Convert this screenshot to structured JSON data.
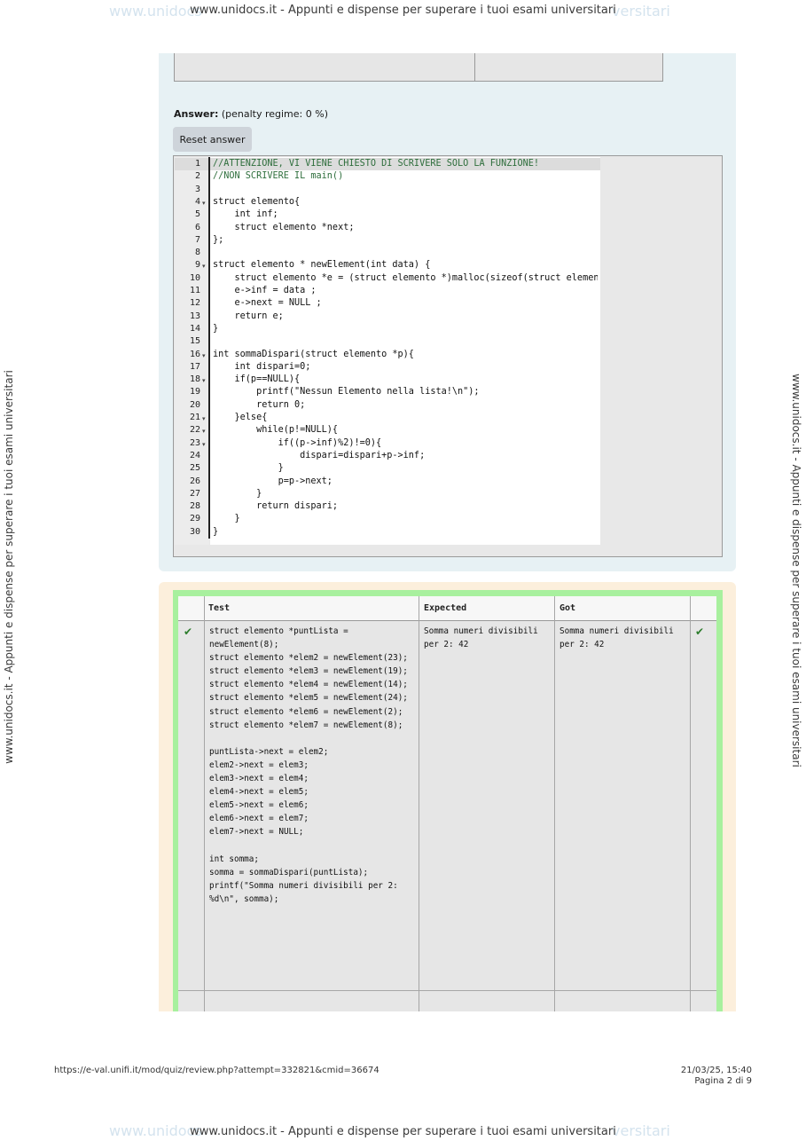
{
  "watermark": {
    "top": "www.unidocs.it - Appunti e dispense per superare i tuoi esami universitari",
    "bottom": "www.unidocs.it - Appunti e dispense per superare i tuoi esami universitari",
    "left": "www.unidocs.it - Appunti e dispense per superare i tuoi esami universitari",
    "right": "www.unidocs.it - Appunti e dispense per superare i tuoi esami universitari",
    "ghost_left": "www.unidocs",
    "ghost_right": "versitari"
  },
  "answer": {
    "label": "Answer:",
    "penalty": "(penalty regime: 0 %)",
    "reset_button": "Reset answer"
  },
  "code_lines": [
    {
      "n": "1",
      "text": "//ATTENZIONE, VI VIENE CHIESTO DI SCRIVERE SOLO LA FUNZIONE!",
      "comment": true
    },
    {
      "n": "2",
      "text": "//NON SCRIVERE IL main()",
      "comment": true
    },
    {
      "n": "3",
      "text": ""
    },
    {
      "n": "4",
      "text": "struct elemento{",
      "fold": true
    },
    {
      "n": "5",
      "text": "    int inf;"
    },
    {
      "n": "6",
      "text": "    struct elemento *next;"
    },
    {
      "n": "7",
      "text": "};"
    },
    {
      "n": "8",
      "text": ""
    },
    {
      "n": "9",
      "text": "struct elemento * newElement(int data) {",
      "fold": true
    },
    {
      "n": "10",
      "text": "    struct elemento *e = (struct elemento *)malloc(sizeof(struct elemento));"
    },
    {
      "n": "11",
      "text": "    e->inf = data ;"
    },
    {
      "n": "12",
      "text": "    e->next = NULL ;"
    },
    {
      "n": "13",
      "text": "    return e;"
    },
    {
      "n": "14",
      "text": "}"
    },
    {
      "n": "15",
      "text": ""
    },
    {
      "n": "16",
      "text": "int sommaDispari(struct elemento *p){",
      "fold": true
    },
    {
      "n": "17",
      "text": "    int dispari=0;"
    },
    {
      "n": "18",
      "text": "    if(p==NULL){",
      "fold": true
    },
    {
      "n": "19",
      "text": "        printf(\"Nessun Elemento nella lista!\\n\");"
    },
    {
      "n": "20",
      "text": "        return 0;"
    },
    {
      "n": "21",
      "text": "    }else{",
      "fold": true
    },
    {
      "n": "22",
      "text": "        while(p!=NULL){",
      "fold": true
    },
    {
      "n": "23",
      "text": "            if((p->inf)%2)!=0){",
      "fold": true
    },
    {
      "n": "24",
      "text": "                dispari=dispari+p->inf;"
    },
    {
      "n": "25",
      "text": "            }"
    },
    {
      "n": "26",
      "text": "            p=p->next;"
    },
    {
      "n": "27",
      "text": "        }"
    },
    {
      "n": "28",
      "text": "        return dispari;"
    },
    {
      "n": "29",
      "text": "    }"
    },
    {
      "n": "30",
      "text": "}"
    }
  ],
  "results": {
    "headers": {
      "test": "Test",
      "expected": "Expected",
      "got": "Got"
    },
    "row": {
      "test": "struct elemento *puntLista = newElement(8);\nstruct elemento *elem2 = newElement(23);\nstruct elemento *elem3 = newElement(19);\nstruct elemento *elem4 = newElement(14);\nstruct elemento *elem5 = newElement(24);\nstruct elemento *elem6 = newElement(2);\nstruct elemento *elem7 = newElement(8);\n\npuntLista->next = elem2;\nelem2->next = elem3;\nelem3->next = elem4;\nelem4->next = elem5;\nelem5->next = elem6;\nelem6->next = elem7;\nelem7->next = NULL;\n\nint somma;\nsomma = sommaDispari(puntLista);\nprintf(\"Somma numeri divisibili per 2: %d\\n\", somma);",
      "expected": "Somma numeri divisibili per 2: 42",
      "got": "Somma numeri divisibili per 2: 42",
      "pass_mark": "✔",
      "status_mark": "✔"
    }
  },
  "footer": {
    "url": "https://e-val.unifi.it/mod/quiz/review.php?attempt=332821&cmid=36674",
    "date": "21/03/25, 15:40",
    "page": "Pagina 2 di 9"
  },
  "colors": {
    "question_bg": "#e7f1f4",
    "results_bg": "#fcefdc",
    "pass_border": "#a8f09e",
    "comment": "#2e6e3c"
  }
}
